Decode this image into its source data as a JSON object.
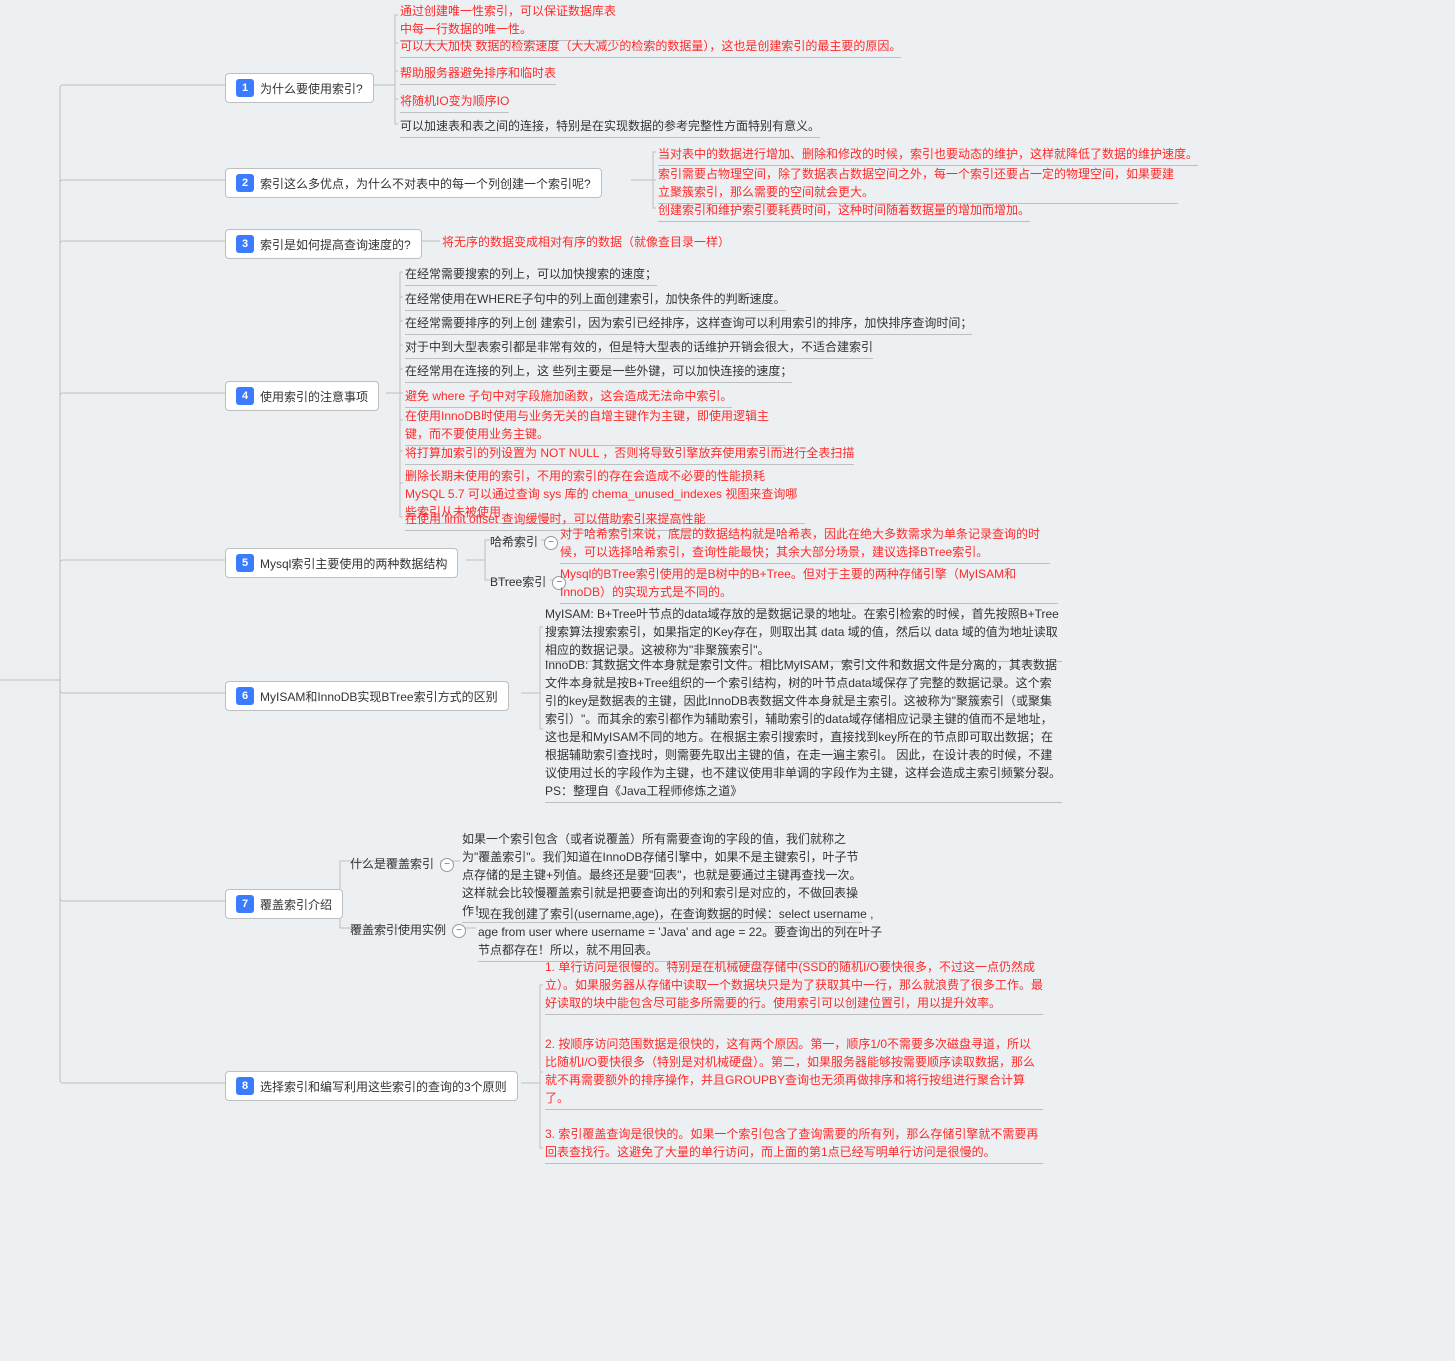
{
  "nodes": {
    "n1": {
      "num": "1",
      "label": "为什么要使用索引?"
    },
    "n2": {
      "num": "2",
      "label": "索引这么多优点，为什么不对表中的每一个列创建一个索引呢?"
    },
    "n3": {
      "num": "3",
      "label": "索引是如何提高查询速度的?"
    },
    "n4": {
      "num": "4",
      "label": "使用索引的注意事项"
    },
    "n5": {
      "num": "5",
      "label": "Mysql索引主要使用的两种数据结构"
    },
    "n6": {
      "num": "6",
      "label": "MyISAM和InnoDB实现BTree索引方式的区别"
    },
    "n7": {
      "num": "7",
      "label": "覆盖索引介绍"
    },
    "n8": {
      "num": "8",
      "label": "选择索引和编写利用这些索引的查询的3个原则"
    }
  },
  "n1_children": [
    "通过创建唯一性索引，可以保证数据库表中每一行数据的唯一性。",
    "可以大大加快 数据的检索速度（大大减少的检索的数据量），这也是创建索引的最主要的原因。",
    "帮助服务器避免排序和临时表",
    "将随机IO变为顺序IO",
    "可以加速表和表之间的连接，特别是在实现数据的参考完整性方面特别有意义。"
  ],
  "n2_children": [
    "当对表中的数据进行增加、删除和修改的时候，索引也要动态的维护，这样就降低了数据的维护速度。",
    "索引需要占物理空间，除了数据表占数据空间之外，每一个索引还要占一定的物理空间，如果要建立聚簇索引，那么需要的空间就会更大。",
    "创建索引和维护索引要耗费时间，这种时间随着数据量的增加而增加。"
  ],
  "n3_child": "将无序的数据变成相对有序的数据（就像查目录一样）",
  "n4_children": [
    {
      "t": "在经常需要搜索的列上，可以加快搜索的速度；",
      "c": "blk"
    },
    {
      "t": "在经常使用在WHERE子句中的列上面创建索引，加快条件的判断速度。",
      "c": "blk"
    },
    {
      "t": "在经常需要排序的列上创 建索引，因为索引已经排序，这样查询可以利用索引的排序，加快排序查询时间；",
      "c": "blk"
    },
    {
      "t": "对于中到大型表索引都是非常有效的，但是特大型表的话维护开销会很大，不适合建索引",
      "c": "blk"
    },
    {
      "t": "在经常用在连接的列上，这 些列主要是一些外键，可以加快连接的速度；",
      "c": "blk"
    },
    {
      "t": "避免 where 子句中对字段施加函数，这会造成无法命中索引。",
      "c": "red"
    },
    {
      "t": "在使用InnoDB时使用与业务无关的自增主键作为主键，即使用逻辑主键，而不要使用业务主键。",
      "c": "red"
    },
    {
      "t": "将打算加索引的列设置为 NOT NULL ，否则将导致引擎放弃使用索引而进行全表扫描",
      "c": "red"
    },
    {
      "t": "删除长期未使用的索引，不用的索引的存在会造成不必要的性能损耗 MySQL 5.7 可以通过查询 sys 库的 chema_unused_indexes 视图来查询哪些索引从未被使用",
      "c": "red"
    },
    {
      "t": "在使用 limit offset 查询缓慢时，可以借助索引来提高性能",
      "c": "red"
    }
  ],
  "n5_labels": {
    "hash": "哈希索引",
    "btree": "BTree索引"
  },
  "n5_hash": "对于哈希索引来说，底层的数据结构就是哈希表，因此在绝大多数需求为单条记录查询的时候，可以选择哈希索引，查询性能最快；其余大部分场景，建议选择BTree索引。",
  "n5_btree": " Mysql的BTree索引使用的是B树中的B+Tree。但对于主要的两种存储引擎（MyISAM和InnoDB）的实现方式是不同的。",
  "n6_p1": " MyISAM: B+Tree叶节点的data域存放的是数据记录的地址。在索引检索的时候，首先按照B+Tree搜索算法搜索索引，如果指定的Key存在，则取出其 data 域的值，然后以 data 域的值为地址读取相应的数据记录。这被称为\"非聚簇索引\"。",
  "n6_p2": "InnoDB: 其数据文件本身就是索引文件。相比MyISAM，索引文件和数据文件是分离的，其表数据文件本身就是按B+Tree组织的一个索引结构，树的叶节点data域保存了完整的数据记录。这个索引的key是数据表的主键，因此InnoDB表数据文件本身就是主索引。这被称为\"聚簇索引（或聚集索引）\"。而其余的索引都作为辅助索引，辅助索引的data域存储相应记录主键的值而不是地址，这也是和MyISAM不同的地方。在根据主索引搜索时，直接找到key所在的节点即可取出数据；在根据辅助索引查找时，则需要先取出主键的值，在走一遍主索引。 因此，在设计表的时候，不建议使用过长的字段作为主键，也不建议使用非单调的字段作为主键，这样会造成主索引频繁分裂。 PS：整理自《Java工程师修炼之道》",
  "n7_labels": {
    "what": "什么是覆盖索引",
    "example": "覆盖索引使用实例"
  },
  "n7_what": "如果一个索引包含（或者说覆盖）所有需要查询的字段的值，我们就称之为\"覆盖索引\"。我们知道在InnoDB存储引擎中，如果不是主键索引，叶子节点存储的是主键+列值。最终还是要\"回表\"，也就是要通过主键再查找一次。这样就会比较慢覆盖索引就是把要查询出的列和索引是对应的，不做回表操作！",
  "n7_example": "现在我创建了索引(username,age)，在查询数据的时候：select username , age from user where username = 'Java' and age = 22。要查询出的列在叶子节点都存在！所以，就不用回表。",
  "n8_children": [
    "1. 单行访问是很慢的。特别是在机械硬盘存储中(SSD的随机I/O要快很多，不过这一点仍然成立）。如果服务器从存储中读取一个数据块只是为了获取其中一行，那么就浪费了很多工作。最好读取的块中能包含尽可能多所需要的行。使用索引可以创建位置引，用以提升效率。",
    "2. 按顺序访问范围数据是很快的，这有两个原因。第一，顺序1/0不需要多次磁盘寻道，所以比随机I/O要快很多（特别是对机械硬盘）。第二，如果服务器能够按需要顺序读取数据，那么就不再需要额外的排序操作，并且GROUPBY查询也无须再做排序和将行按组进行聚合计算了。",
    "3. 索引覆盖查询是很快的。如果一个索引包含了查询需要的所有列，那么存储引擎就不需要再回表查找行。这避免了大量的单行访问，而上面的第1点已经写明单行访问是很慢的。"
  ]
}
